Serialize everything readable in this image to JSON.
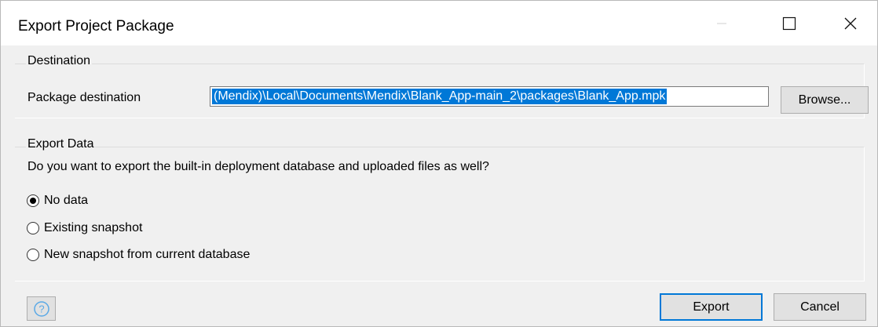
{
  "window": {
    "title": "Export Project Package"
  },
  "destination": {
    "legend": "Destination",
    "label": "Package destination",
    "value": "(Mendix)\\Local\\Documents\\Mendix\\Blank_App-main_2\\packages\\Blank_App.mpk",
    "browse_label": "Browse..."
  },
  "export_data": {
    "legend": "Export Data",
    "question": "Do you want to export the built-in deployment database and uploaded files as well?",
    "options": [
      {
        "label": "No data",
        "selected": true
      },
      {
        "label": "Existing snapshot",
        "selected": false
      },
      {
        "label": "New snapshot from current database",
        "selected": false
      }
    ]
  },
  "footer": {
    "help_icon": "question-circle-icon",
    "export_label": "Export",
    "cancel_label": "Cancel"
  },
  "colors": {
    "accent": "#0078d7",
    "help_icon": "#5aa9e6"
  }
}
